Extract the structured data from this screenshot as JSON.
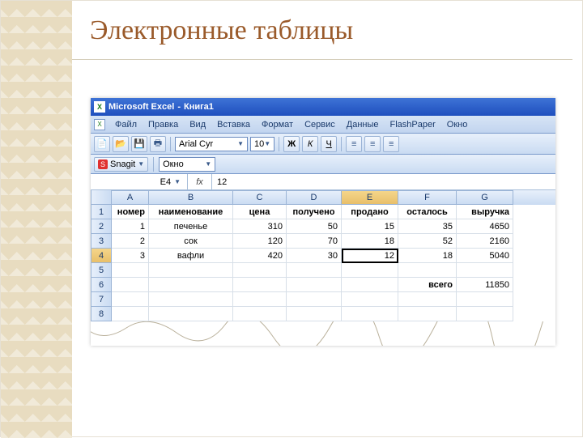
{
  "slide": {
    "title": "Электронные таблицы"
  },
  "titlebar": {
    "app": "Microsoft Excel",
    "doc": "Книга1"
  },
  "menubar": {
    "items": [
      "Файл",
      "Правка",
      "Вид",
      "Вставка",
      "Формат",
      "Сервис",
      "Данные",
      "FlashPaper",
      "Окно"
    ]
  },
  "toolbar1": {
    "font": "Arial Cyr",
    "size": "10",
    "bold": "Ж",
    "italic": "К",
    "underline": "Ч"
  },
  "toolbar2": {
    "snagit": "Snagit",
    "okno": "Окно"
  },
  "fx": {
    "namebox": "E4",
    "label": "fx",
    "value": "12"
  },
  "grid": {
    "col_labels": [
      "A",
      "B",
      "C",
      "D",
      "E",
      "F",
      "G"
    ],
    "row_labels": [
      "1",
      "2",
      "3",
      "4",
      "5",
      "6",
      "7",
      "8"
    ],
    "header_row": {
      "A": "номер",
      "B": "наименование",
      "C": "цена",
      "D": "получено",
      "E": "продано",
      "F": "осталось",
      "G": "выручка"
    },
    "data": [
      {
        "A": "1",
        "B": "печенье",
        "C": "310",
        "D": "50",
        "E": "15",
        "F": "35",
        "G": "4650"
      },
      {
        "A": "2",
        "B": "сок",
        "C": "120",
        "D": "70",
        "E": "18",
        "F": "52",
        "G": "2160"
      },
      {
        "A": "3",
        "B": "вафли",
        "C": "420",
        "D": "30",
        "E": "12",
        "F": "18",
        "G": "5040"
      }
    ],
    "total_row": {
      "F": "всего",
      "G": "11850"
    },
    "selected_cell": "E4"
  }
}
